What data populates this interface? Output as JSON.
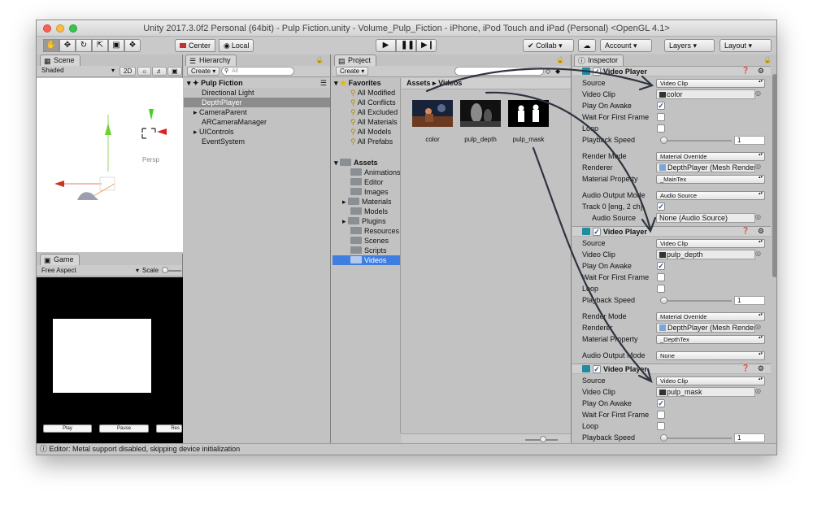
{
  "window": {
    "title": "Unity 2017.3.0f2 Personal (64bit) - Pulp Fiction.unity - Volume_Pulp_Fiction - iPhone, iPod Touch and iPad (Personal) <OpenGL 4.1>"
  },
  "toolbar": {
    "center_label": "Center",
    "local_label": "Local",
    "collab_label": "Collab",
    "account_label": "Account",
    "layers_label": "Layers",
    "layout_label": "Layout"
  },
  "scene": {
    "tab_label": "Scene",
    "shading": "Shaded",
    "mode_2d": "2D",
    "persp_label": "Persp"
  },
  "game": {
    "tab_label": "Game",
    "aspect": "Free Aspect",
    "scale_label": "Scale",
    "buttons": [
      "Play",
      "Pause",
      "Res"
    ]
  },
  "hierarchy": {
    "tab_label": "Hierarchy",
    "create_label": "Create",
    "search_placeholder": "All",
    "scene_name": "Pulp Fiction",
    "items": [
      "Directional Light",
      "DepthPlayer",
      "CameraParent",
      "ARCameraManager",
      "UIControls",
      "EventSystem"
    ]
  },
  "project": {
    "tab_label": "Project",
    "create_label": "Create",
    "favorites_label": "Favorites",
    "favorites": [
      "All Modified",
      "All Conflicts",
      "All Excluded",
      "All Materials",
      "All Models",
      "All Prefabs"
    ],
    "assets_label": "Assets",
    "folders": [
      "Animations",
      "Editor",
      "Images",
      "Materials",
      "Models",
      "Plugins",
      "Resources",
      "Scenes",
      "Scripts",
      "Videos"
    ],
    "breadcrumb": [
      "Assets",
      "Videos"
    ],
    "files": [
      "color",
      "pulp_depth",
      "pulp_mask"
    ]
  },
  "inspector": {
    "tab_label": "Inspector",
    "components": [
      {
        "title": "Video Player",
        "rows": [
          {
            "label": "Source",
            "kind": "dropdown",
            "value": "Video Clip"
          },
          {
            "label": "Video Clip",
            "kind": "object",
            "value": "color"
          },
          {
            "label": "Play On Awake",
            "kind": "check",
            "checked": true
          },
          {
            "label": "Wait For First Frame",
            "kind": "check",
            "checked": false
          },
          {
            "label": "Loop",
            "kind": "check",
            "checked": false
          },
          {
            "label": "Playback Speed",
            "kind": "slider",
            "value": "1"
          },
          {
            "label": "Render Mode",
            "kind": "dropdown",
            "value": "Material Override"
          },
          {
            "label": "Renderer",
            "kind": "object",
            "value": "DepthPlayer (Mesh Render"
          },
          {
            "label": "Material Property",
            "kind": "dropdown",
            "value": "_MainTex"
          },
          {
            "label": "Audio Output Mode",
            "kind": "dropdown",
            "value": "Audio Source"
          },
          {
            "label": "Track 0 [eng, 2 ch]",
            "kind": "check",
            "checked": true
          },
          {
            "label": "Audio Source",
            "kind": "object",
            "value": "None (Audio Source)"
          }
        ]
      },
      {
        "title": "Video Player",
        "rows": [
          {
            "label": "Source",
            "kind": "dropdown",
            "value": "Video Clip"
          },
          {
            "label": "Video Clip",
            "kind": "object",
            "value": "pulp_depth"
          },
          {
            "label": "Play On Awake",
            "kind": "check",
            "checked": true
          },
          {
            "label": "Wait For First Frame",
            "kind": "check",
            "checked": false
          },
          {
            "label": "Loop",
            "kind": "check",
            "checked": false
          },
          {
            "label": "Playback Speed",
            "kind": "slider",
            "value": "1"
          },
          {
            "label": "Render Mode",
            "kind": "dropdown",
            "value": "Material Override"
          },
          {
            "label": "Renderer",
            "kind": "object",
            "value": "DepthPlayer (Mesh Render"
          },
          {
            "label": "Material Property",
            "kind": "dropdown",
            "value": "_DepthTex"
          },
          {
            "label": "Audio Output Mode",
            "kind": "dropdown",
            "value": "None"
          }
        ]
      },
      {
        "title": "Video Player",
        "rows": [
          {
            "label": "Source",
            "kind": "dropdown",
            "value": "Video Clip"
          },
          {
            "label": "Video Clip",
            "kind": "object",
            "value": "pulp_mask"
          },
          {
            "label": "Play On Awake",
            "kind": "check",
            "checked": true
          },
          {
            "label": "Wait For First Frame",
            "kind": "check",
            "checked": false
          },
          {
            "label": "Loop",
            "kind": "check",
            "checked": false
          },
          {
            "label": "Playback Speed",
            "kind": "slider",
            "value": "1"
          }
        ]
      }
    ]
  },
  "status": {
    "message": "Editor: Metal support disabled, skipping device initialization"
  }
}
